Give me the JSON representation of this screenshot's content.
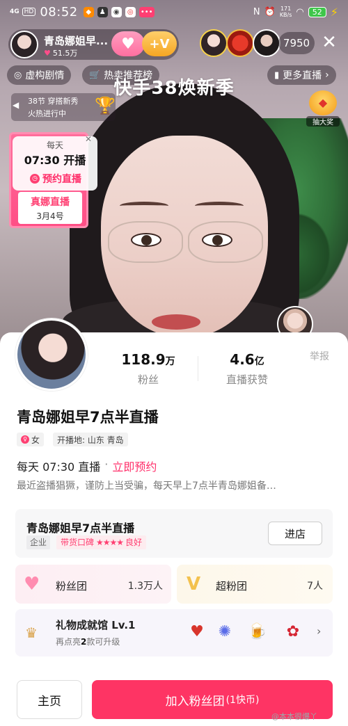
{
  "status_bar": {
    "signal": "4G",
    "hd": "HD",
    "time": "08:52",
    "speed_value": "171",
    "speed_unit": "KB/s",
    "battery": "52"
  },
  "header": {
    "streamer_name": "青岛娜姐早...",
    "likes": "51.5万",
    "follow_label": "+V",
    "viewer_count": "7950"
  },
  "chips": {
    "drama": "虚构剧情",
    "hot_sales": "热卖推荐榜",
    "more_live": "更多直播"
  },
  "banner_title": "快手38焕新季",
  "task": {
    "line1": "38节 穿搭新秀",
    "line2": "火热进行中"
  },
  "lottery_label": "抽大奖",
  "reservation": {
    "daily": "每天",
    "time": "07:30 开播",
    "button": "预约直播",
    "card_title": "真娜直播",
    "card_date": "3月4号"
  },
  "profile": {
    "fans_value": "118.9",
    "fans_unit": "万",
    "fans_label": "粉丝",
    "likes_value": "4.6",
    "likes_unit": "亿",
    "likes_label": "直播获赞",
    "report": "举报",
    "title": "青岛娜姐早7点半直播",
    "gender": "女",
    "location": "开播地: 山东 青岛",
    "schedule": "每天 07:30 直播",
    "schedule_sep": "·",
    "reserve_now": "立即预约",
    "description": "最近盗播猖獗，谨防上当受骗，每天早上7点半青岛娜姐备…"
  },
  "shop": {
    "name": "青岛娜姐早7点半直播",
    "tag": "企业",
    "rating_label": "带货口碑",
    "stars": "★★★★",
    "rating_text": "良好",
    "enter_button": "进店"
  },
  "fan_club": {
    "name": "粉丝团",
    "count": "1.3万人"
  },
  "super_club": {
    "name": "超粉团",
    "count": "7人"
  },
  "gift_hall": {
    "title": "礼物成就馆 Lv.1",
    "sub_prefix": "再点亮",
    "sub_number": "2",
    "sub_suffix": "款可升级"
  },
  "bottom": {
    "home": "主页",
    "join": "加入粉丝团",
    "join_price": "(1快币)"
  },
  "watermark": "@本本很爆丫",
  "colors": {
    "accent": "#fe3464",
    "reserve": "#ff2f6a",
    "battery": "#3ec64a"
  },
  "icons": [
    "heart-icon",
    "v-badge-icon",
    "close-icon",
    "drama-icon",
    "cart-icon",
    "chart-icon",
    "trophy-icon",
    "lottery-icon",
    "clock-icon",
    "crown-icon",
    "chevron-right-icon"
  ]
}
